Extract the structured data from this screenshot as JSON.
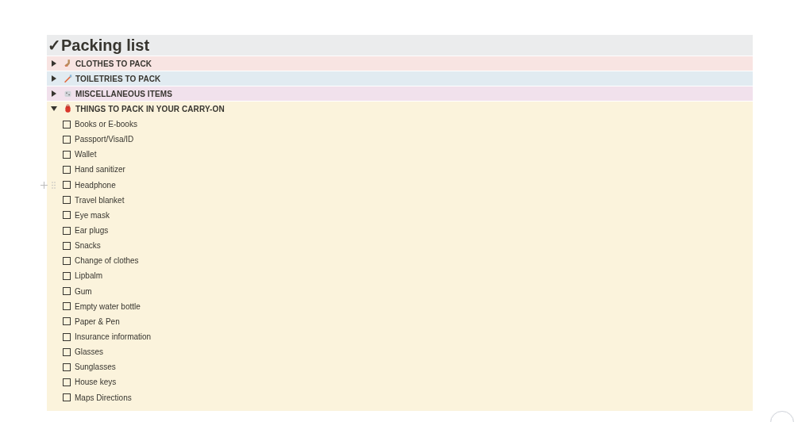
{
  "title": "✓Packing list",
  "sections": [
    {
      "label": "CLOTHES TO PACK",
      "kind": "sock",
      "color": "#f8e4e2",
      "expanded": false
    },
    {
      "label": "TOILETRIES TO PACK",
      "kind": "toothbrush",
      "color": "#e1ebf1",
      "expanded": false
    },
    {
      "label": "MISCELLANEOUS ITEMS",
      "kind": "dice",
      "color": "#f1e1ec",
      "expanded": false
    },
    {
      "label": "THINGS TO PACK IN YOUR CARRY-ON",
      "kind": "backpack",
      "color": "#fbf3dc",
      "expanded": true,
      "items": [
        {
          "text": "Books or E-books",
          "checked": false,
          "hovered": false
        },
        {
          "text": "Passport/Visa/ID",
          "checked": false,
          "hovered": false
        },
        {
          "text": "Wallet",
          "checked": false,
          "hovered": false
        },
        {
          "text": "Hand sanitizer",
          "checked": false,
          "hovered": false
        },
        {
          "text": "Headphone",
          "checked": false,
          "hovered": true
        },
        {
          "text": "Travel blanket",
          "checked": false,
          "hovered": false
        },
        {
          "text": "Eye mask",
          "checked": false,
          "hovered": false
        },
        {
          "text": "Ear plugs",
          "checked": false,
          "hovered": false
        },
        {
          "text": "Snacks",
          "checked": false,
          "hovered": false
        },
        {
          "text": "Change of clothes",
          "checked": false,
          "hovered": false
        },
        {
          "text": "Lipbalm",
          "checked": false,
          "hovered": false
        },
        {
          "text": "Gum",
          "checked": false,
          "hovered": false
        },
        {
          "text": "Empty water bottle",
          "checked": false,
          "hovered": false
        },
        {
          "text": "Paper & Pen",
          "checked": false,
          "hovered": false
        },
        {
          "text": "Insurance information",
          "checked": false,
          "hovered": false
        },
        {
          "text": "Glasses",
          "checked": false,
          "hovered": false
        },
        {
          "text": "Sunglasses",
          "checked": false,
          "hovered": false
        },
        {
          "text": "House keys",
          "checked": false,
          "hovered": false
        },
        {
          "text": "Maps Directions",
          "checked": false,
          "hovered": false
        }
      ]
    }
  ]
}
